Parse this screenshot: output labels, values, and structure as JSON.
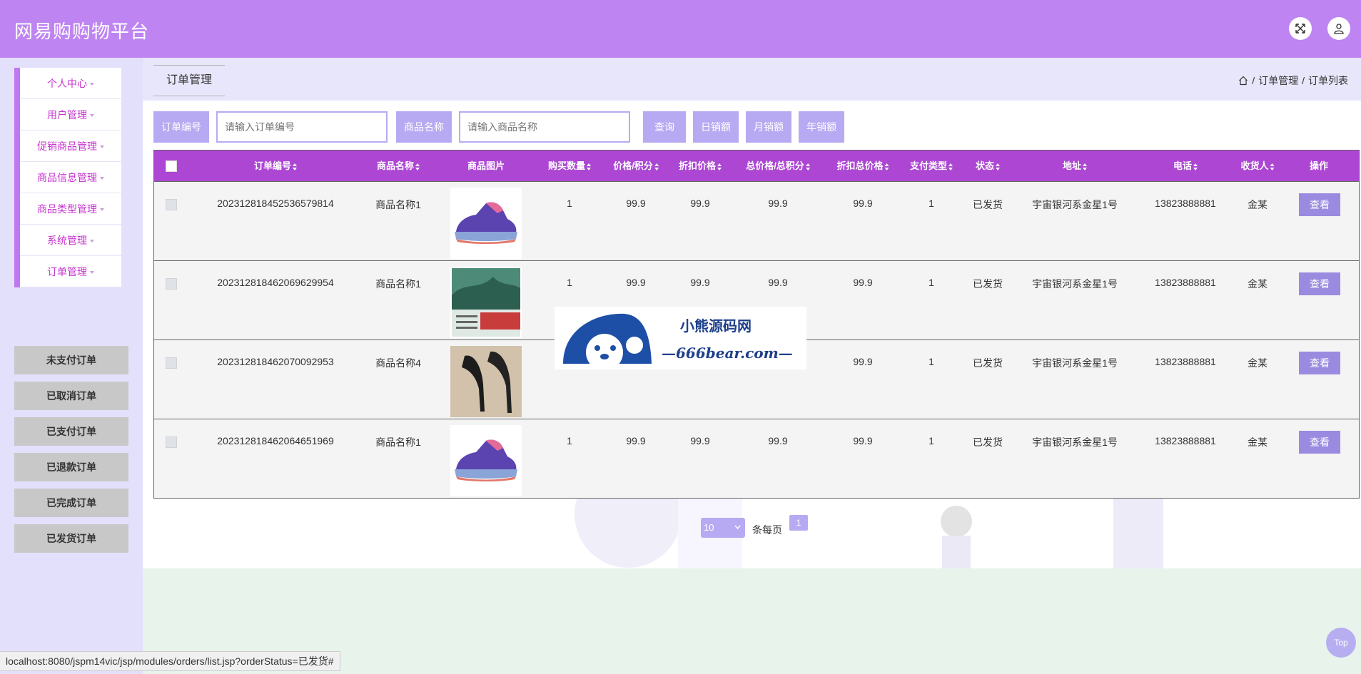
{
  "app": {
    "title": "网易购购物平台"
  },
  "sidebar": {
    "menu": [
      {
        "label": "个人中心"
      },
      {
        "label": "用户管理"
      },
      {
        "label": "促销商品管理"
      },
      {
        "label": "商品信息管理"
      },
      {
        "label": "商品类型管理"
      },
      {
        "label": "系统管理"
      },
      {
        "label": "订单管理"
      }
    ],
    "submenu": [
      {
        "label": "未支付订单"
      },
      {
        "label": "已取消订单"
      },
      {
        "label": "已支付订单"
      },
      {
        "label": "已退款订单"
      },
      {
        "label": "已完成订单"
      },
      {
        "label": "已发货订单"
      }
    ]
  },
  "page": {
    "tab_title": "订单管理",
    "breadcrumb": {
      "sep1": "/",
      "item1": "订单管理",
      "sep2": "/",
      "item2": "订单列表"
    }
  },
  "search": {
    "order_no_label": "订单编号",
    "order_no_placeholder": "请输入订单编号",
    "product_name_label": "商品名称",
    "product_name_placeholder": "请输入商品名称",
    "query_btn": "查询",
    "daily_btn": "日销额",
    "monthly_btn": "月销额",
    "yearly_btn": "年销额"
  },
  "table": {
    "headers": [
      "订单编号",
      "商品名称",
      "商品图片",
      "购买数量",
      "价格/积分",
      "折扣价格",
      "总价格/总积分",
      "折扣总价格",
      "支付类型",
      "状态",
      "地址",
      "电话",
      "收货人",
      "操作"
    ],
    "rows": [
      {
        "order_no": "2023128184525365798​14",
        "name": "商品名称1",
        "image": "sneaker",
        "qty": "1",
        "price": "99.9",
        "discount": "99.9",
        "total": "99.9",
        "discount_total": "99.9",
        "pay_type": "1",
        "status": "已发货",
        "address": "宇宙银河系金星1号",
        "phone": "13823888881",
        "receiver": "金某",
        "action": "查看"
      },
      {
        "order_no": "20231281846206962​9954",
        "name": "商品名称1",
        "image": "book",
        "qty": "1",
        "price": "99.9",
        "discount": "99.9",
        "total": "99.9",
        "discount_total": "99.9",
        "pay_type": "1",
        "status": "已发货",
        "address": "宇宙银河系金星1号",
        "phone": "13823888881",
        "receiver": "金某",
        "action": "查看"
      },
      {
        "order_no": "202312818462070092953",
        "name": "商品名称4",
        "image": "heels",
        "qty": "",
        "price": "",
        "discount": "",
        "total": "",
        "discount_total": "99.9",
        "pay_type": "1",
        "status": "已发货",
        "address": "宇宙银河系金星1号",
        "phone": "13823888881",
        "receiver": "金某",
        "action": "查看"
      },
      {
        "order_no": "202312818462064651969",
        "name": "商品名称1",
        "image": "sneaker",
        "qty": "1",
        "price": "99.9",
        "discount": "99.9",
        "total": "99.9",
        "discount_total": "99.9",
        "pay_type": "1",
        "status": "已发货",
        "address": "宇宙银河系金星1号",
        "phone": "13823888881",
        "receiver": "金某",
        "action": "查看"
      }
    ]
  },
  "pager": {
    "page_size": "10",
    "per_page_label": "条每页",
    "current_page": "1"
  },
  "watermark": {
    "title": "小熊源码网",
    "subtitle": "—666bear.com—"
  },
  "status_url": "localhost:8080/jspm14vic/jsp/modules/orders/list.jsp?orderStatus=已发货#",
  "top_button": "Top",
  "colors": {
    "header": "#be85f2",
    "table_header": "#ac46d3",
    "accent": "#b8aaf2",
    "menu_text": "#c634cf"
  }
}
